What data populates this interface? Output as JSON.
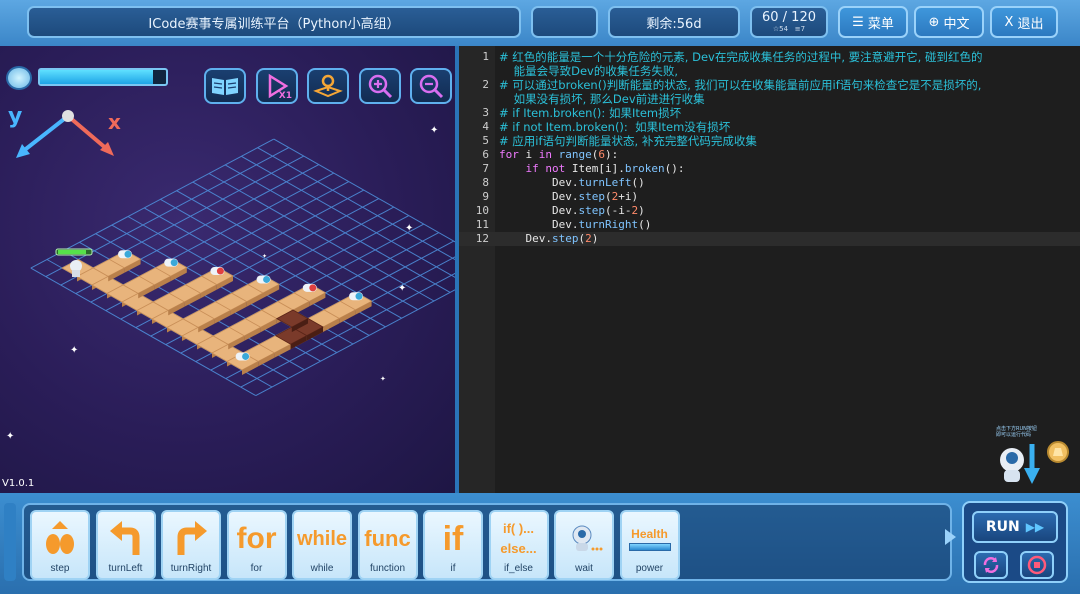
{
  "header": {
    "title": "ICode赛事专属训练平台（Python小高组）",
    "remaining": "剩余:56d",
    "score": "60 / 120",
    "score_sub_a": "54",
    "score_sub_b": "7",
    "menu_label": "菜单",
    "lang_label": "中文",
    "exit_label": "退出"
  },
  "game": {
    "energy_level": 0.9,
    "axis_y": "y",
    "axis_x": "x",
    "speed_label": "X1",
    "version": "V1.0.1",
    "colors": {
      "tile": "#e8b47c",
      "grid": "#5aa0e8",
      "red_item": "#e04040",
      "blue_item": "#3aa8d8"
    }
  },
  "editor": {
    "lines": [
      {
        "n": "1",
        "text": "# 红色的能量是一个十分危险的元素, Dev在完成收集任务的过程中, 要注意避开它, 碰到红色的"
      },
      {
        "n": "",
        "text": "    能量会导致Dev的收集任务失败,"
      },
      {
        "n": "2",
        "text": "# 可以通过broken()判断能量的状态, 我们可以在收集能量前应用if语句来检查它是不是损坏的,"
      },
      {
        "n": "",
        "text": "    如果没有损坏, 那么Dev前进进行收集"
      },
      {
        "n": "3",
        "text": "# if Item.broken(): 如果Item损坏"
      },
      {
        "n": "4",
        "text": "# if not Item.broken():  如果Item没有损坏"
      },
      {
        "n": "5",
        "text": "# 应用if语句判断能量状态, 补充完整代码完成收集"
      },
      {
        "n": "6",
        "text": "for i in range(6):"
      },
      {
        "n": "7",
        "text": "    if not Item[i].broken():"
      },
      {
        "n": "8",
        "text": "        Dev.turnLeft()"
      },
      {
        "n": "9",
        "text": "        Dev.step(2+i)"
      },
      {
        "n": "10",
        "text": "        Dev.step(-i-2)"
      },
      {
        "n": "11",
        "text": "        Dev.turnRight()"
      },
      {
        "n": "12",
        "text": "    Dev.step(2)"
      }
    ],
    "helper_text_1": "点击下方RUN按钮",
    "helper_text_2": "即可以运行代码"
  },
  "toolbar": {
    "blocks": [
      {
        "label": "step",
        "icon": "footprints-icon"
      },
      {
        "label": "turnLeft",
        "icon": "turn-left-arrow-icon"
      },
      {
        "label": "turnRight",
        "icon": "turn-right-arrow-icon"
      },
      {
        "label": "for",
        "icon": "for"
      },
      {
        "label": "while",
        "icon": "while"
      },
      {
        "label": "function",
        "icon": "func"
      },
      {
        "label": "if",
        "icon": "if"
      },
      {
        "label": "if_else",
        "icon": "if( )...else..."
      },
      {
        "label": "wait",
        "icon": "robot-wait-icon"
      },
      {
        "label": "power",
        "icon": "Health"
      }
    ],
    "run_label": "RUN"
  }
}
